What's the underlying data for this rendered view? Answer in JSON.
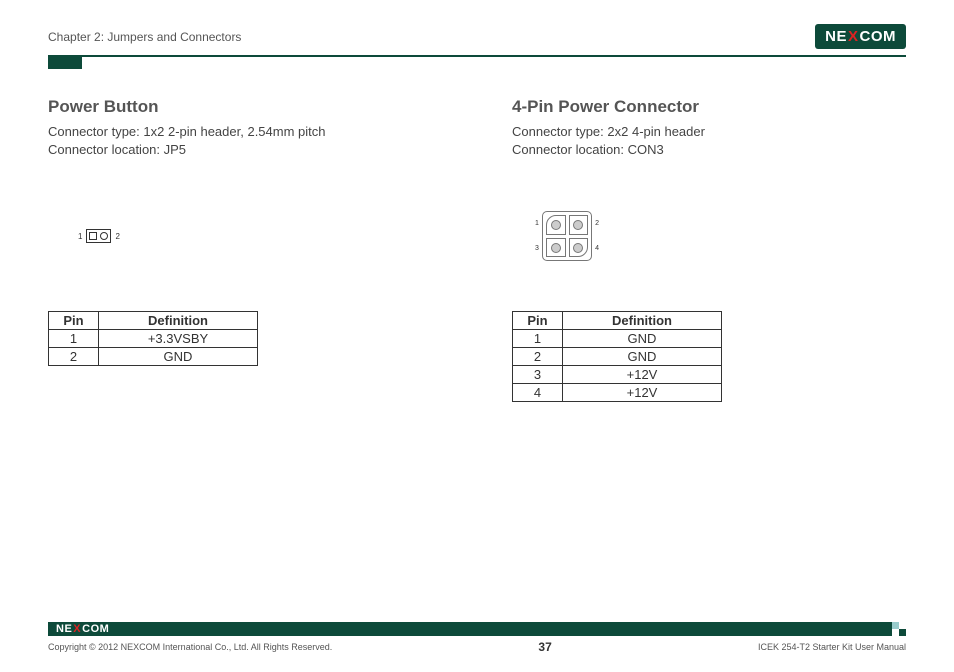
{
  "header": {
    "chapter": "Chapter 2: Jumpers and Connectors",
    "logo_pre": "NE",
    "logo_x": "X",
    "logo_post": "COM"
  },
  "left": {
    "title": "Power Button",
    "type_line": "Connector type: 1x2 2-pin header, 2.54mm pitch",
    "location_line": "Connector location: JP5",
    "pin_labels": {
      "left": "1",
      "right": "2"
    },
    "table": {
      "headers": {
        "pin": "Pin",
        "def": "Definition"
      },
      "rows": [
        {
          "pin": "1",
          "def": "+3.3VSBY"
        },
        {
          "pin": "2",
          "def": "GND"
        }
      ]
    }
  },
  "right": {
    "title": "4-Pin Power Connector",
    "type_line": "Connector type: 2x2 4-pin header",
    "location_line": "Connector location: CON3",
    "pin_labels": {
      "p1": "1",
      "p2": "2",
      "p3": "3",
      "p4": "4"
    },
    "table": {
      "headers": {
        "pin": "Pin",
        "def": "Definition"
      },
      "rows": [
        {
          "pin": "1",
          "def": "GND"
        },
        {
          "pin": "2",
          "def": "GND"
        },
        {
          "pin": "3",
          "def": "+12V"
        },
        {
          "pin": "4",
          "def": "+12V"
        }
      ]
    }
  },
  "footer": {
    "copyright": "Copyright © 2012 NEXCOM International Co., Ltd. All Rights Reserved.",
    "page": "37",
    "manual": "ICEK 254-T2 Starter Kit User Manual"
  }
}
